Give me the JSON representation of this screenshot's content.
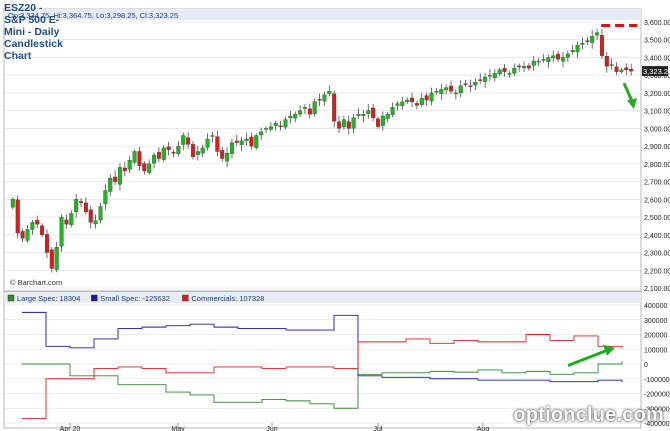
{
  "title": "ESZ20 - S&P 500 E-Mini - Daily Candlestick Chart",
  "ohlc_text": "Op:3,334.75, Hi:3,364.75, Lo:3,298.25, Cl:3,323.25",
  "copyright": "© Barchart.com",
  "watermark": "optionclue.com",
  "last_price_label": "3,323.25",
  "colors": {
    "up": "#22b422",
    "down": "#d42020",
    "large_spec": "#2e8b2e",
    "small_spec": "#1a1aa0",
    "commercials": "#d42020",
    "annotation_green": "#22aa22",
    "annotation_red": "#e01010",
    "header_band": "#e8eaf4",
    "grid": "#dcdcdc"
  },
  "chart_data": [
    {
      "type": "candlestick",
      "title": "ESZ20 - S&P 500 E-Mini - Daily Candlestick Chart",
      "ylim": [
        2100,
        3600
      ],
      "yticks": [
        "2,100.00",
        "2,200.00",
        "2,300.00",
        "2,400.00",
        "2,500.00",
        "2,600.00",
        "2,700.00",
        "2,800.00",
        "2,900.00",
        "3,000.00",
        "3,100.00",
        "3,200.00",
        "3,300.00",
        "3,400.00",
        "3,500.00",
        "3,600.00"
      ],
      "xticks": [
        "Apr 20",
        "May",
        "Jun",
        "Jul",
        "Aug"
      ],
      "close": [
        2600,
        2410,
        2380,
        2430,
        2470,
        2460,
        2400,
        2300,
        2210,
        2330,
        2500,
        2460,
        2520,
        2600,
        2580,
        2530,
        2470,
        2480,
        2560,
        2650,
        2720,
        2700,
        2780,
        2760,
        2820,
        2870,
        2790,
        2760,
        2800,
        2850,
        2830,
        2890,
        2880,
        2860,
        2900,
        2960,
        2910,
        2840,
        2870,
        2890,
        2940,
        2960,
        2870,
        2830,
        2860,
        2920,
        2920,
        2930,
        2940,
        2900,
        2960,
        2980,
        3000,
        3010,
        3030,
        3010,
        3050,
        3070,
        3080,
        3100,
        3120,
        3080,
        3150,
        3160,
        3190,
        3210,
        3040,
        3000,
        3050,
        3000,
        3060,
        3080,
        3080,
        3100,
        3060,
        3010,
        3070,
        3080,
        3120,
        3140,
        3150,
        3160,
        3150,
        3130,
        3170,
        3160,
        3200,
        3210,
        3220,
        3230,
        3210,
        3200,
        3240,
        3250,
        3240,
        3260,
        3270,
        3290,
        3300,
        3310,
        3330,
        3320,
        3310,
        3340,
        3350,
        3350,
        3340,
        3380,
        3380,
        3390,
        3400,
        3410,
        3390,
        3400,
        3420,
        3440,
        3470,
        3480,
        3490,
        3520,
        3540,
        3410,
        3350,
        3360,
        3320,
        3330,
        3330,
        3323
      ],
      "ohlc_last": {
        "open": 3334.75,
        "high": 3364.75,
        "low": 3298.25,
        "close": 3323.25
      },
      "annotations": {
        "resistance_level": 3580,
        "arrow_from": 3255,
        "arrow_to": 3120
      }
    },
    {
      "type": "line",
      "title": "COT",
      "ylim": [
        -400000,
        400000
      ],
      "yticks": [
        "400000",
        "300000",
        "200000",
        "100000",
        "0",
        "-100000",
        "-200000",
        "-300000",
        "-400000"
      ],
      "series": [
        {
          "name": "Large Spec: 18304",
          "values": [
            0,
            0,
            -80000,
            -80000,
            -140000,
            -140000,
            -190000,
            -210000,
            -260000,
            -260000,
            -240000,
            -250000,
            -270000,
            -300000,
            -70000,
            -60000,
            -60000,
            -50000,
            -55000,
            -40000,
            -60000,
            -50000,
            -70000,
            -60000,
            0,
            18304
          ]
        },
        {
          "name": "Small Spec: -125632",
          "values": [
            350000,
            120000,
            110000,
            170000,
            240000,
            250000,
            260000,
            270000,
            250000,
            240000,
            240000,
            230000,
            230000,
            330000,
            -80000,
            -90000,
            -90000,
            -100000,
            -100000,
            -110000,
            -110000,
            -110000,
            -120000,
            -120000,
            -110000,
            -125632
          ]
        },
        {
          "name": "Commercials: 107328",
          "values": [
            -370000,
            -100000,
            -100000,
            -30000,
            -20000,
            -30000,
            -60000,
            -60000,
            -20000,
            -20000,
            -30000,
            -20000,
            -20000,
            -30000,
            150000,
            150000,
            170000,
            140000,
            160000,
            150000,
            150000,
            200000,
            160000,
            190000,
            120000,
            107328
          ]
        }
      ],
      "annotations": {
        "arrow_from": -10000,
        "arrow_to": 110000
      }
    }
  ]
}
